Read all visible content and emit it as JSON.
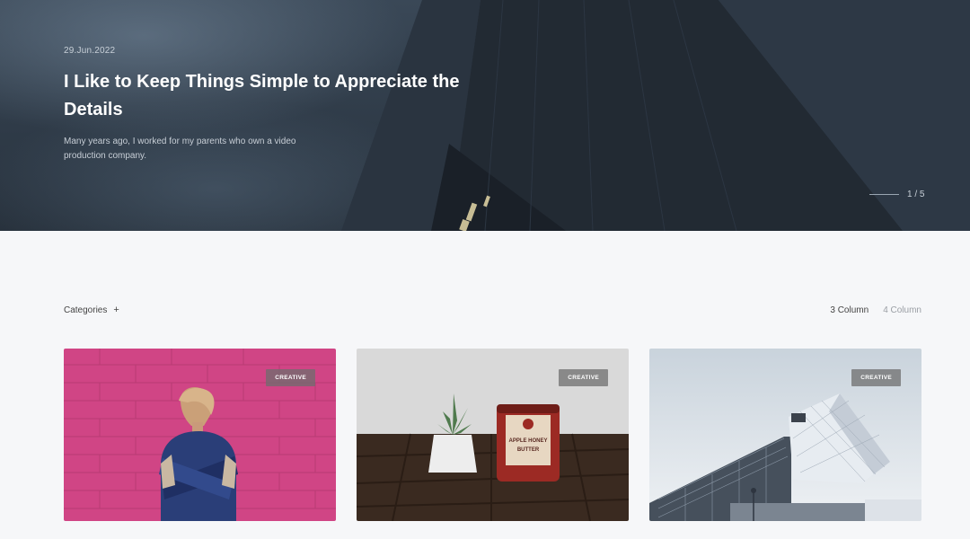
{
  "hero": {
    "date": "29.Jun.2022",
    "title": "I Like to Keep Things Simple to Appreciate the Details",
    "description": "Many years ago, I worked for my parents who own a video production company.",
    "pager": "1 / 5"
  },
  "toolbar": {
    "categories_label": "Categories",
    "categories_icon": "+",
    "columns": [
      {
        "label": "3 Column",
        "active": true
      },
      {
        "label": "4 Column",
        "active": false
      }
    ]
  },
  "cards": [
    {
      "badge": "CREATIVE",
      "image": "woman-pink-wall"
    },
    {
      "badge": "CREATIVE",
      "image": "candle-succulent",
      "candle_text": [
        "APPLE HONEY",
        "BUTTER"
      ]
    },
    {
      "badge": "CREATIVE",
      "image": "modern-building"
    }
  ]
}
